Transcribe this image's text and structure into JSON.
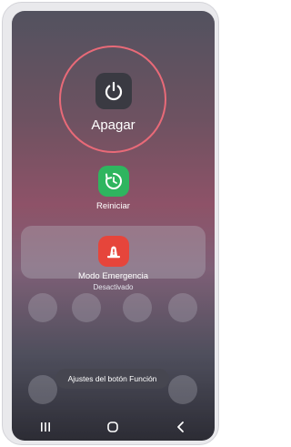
{
  "power_menu": {
    "power_off": {
      "label": "Apagar",
      "icon": "power-icon"
    },
    "restart": {
      "label": "Reiniciar",
      "icon": "restart-icon"
    },
    "emergency": {
      "label": "Modo Emergencia",
      "status": "Desactivado",
      "icon": "emergency-icon"
    },
    "function_key_settings": {
      "label": "Ajustes del botón Función"
    }
  },
  "navbar": {
    "items": [
      {
        "icon": "recents-icon"
      },
      {
        "icon": "home-icon"
      },
      {
        "icon": "back-icon"
      }
    ]
  },
  "colors": {
    "highlight_ring": "#e86a78",
    "restart_green": "#2fb55f",
    "emergency_red": "#e6453b",
    "power_dark": "#3a3a42"
  }
}
